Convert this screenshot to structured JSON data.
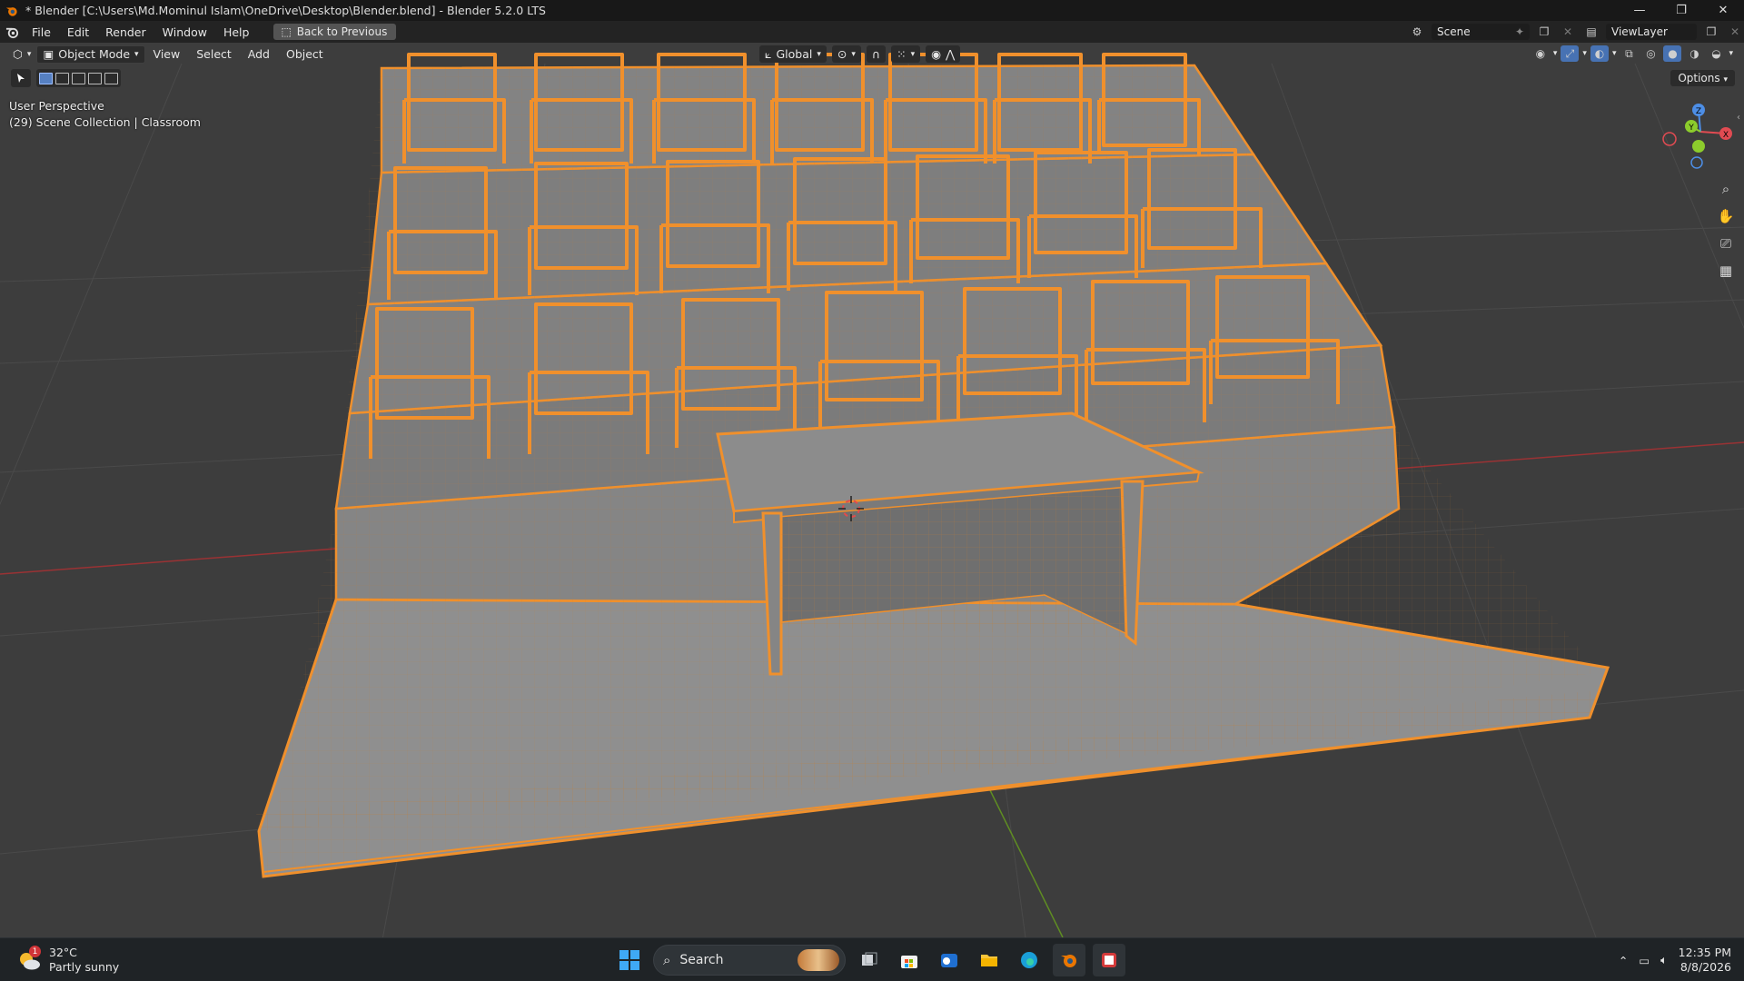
{
  "window": {
    "title": "* Blender [C:\\Users\\Md.Mominul Islam\\OneDrive\\Desktop\\Blender.blend] - Blender 5.2.0 LTS",
    "controls": [
      "—",
      "❐",
      "✕"
    ]
  },
  "menubar": {
    "items": [
      "File",
      "Edit",
      "Render",
      "Window",
      "Help"
    ],
    "back_button": "Back to Previous",
    "scene": "Scene",
    "view_layer": "ViewLayer"
  },
  "viewport_header": {
    "mode": "Object Mode",
    "menus": [
      "View",
      "Select",
      "Add",
      "Object"
    ],
    "orientation": "Global"
  },
  "viewport": {
    "perspective": "User Perspective",
    "collection_info": "(29) Scene Collection | Classroom",
    "options": "Options",
    "gizmo_axes": [
      "X",
      "Y",
      "Z"
    ],
    "colors": {
      "background": "#3d3d3d",
      "selection_outline": "#f0902c",
      "mesh_surface": "#8e8e8e",
      "axis_x": "#c0393b",
      "axis_y": "#6a9e2a"
    }
  },
  "taskbar": {
    "weather_temp": "32°C",
    "weather_desc": "Partly sunny",
    "weather_badge": "1",
    "search_placeholder": "Search",
    "time": "12:35 PM",
    "date": "8/8/2026",
    "pinned": [
      "start-icon",
      "search",
      "task-view-icon",
      "store-icon",
      "outlook-icon",
      "file-explorer-icon",
      "edge-icon",
      "blender-icon",
      "snipping-tool-icon"
    ]
  }
}
